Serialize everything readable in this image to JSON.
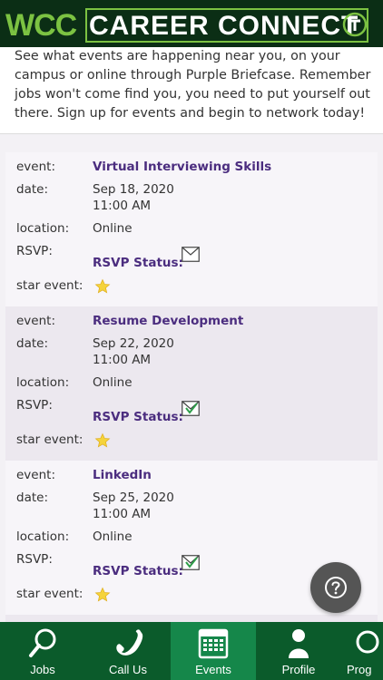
{
  "header": {
    "brand_short": "WCC",
    "brand_name": "CAREER CONNECT"
  },
  "intro": {
    "text": "See what events are happening near you, on your campus or online through Purple Briefcase. Remember jobs won't come find you, you need to put yourself out there. Sign up for events and begin to network today!"
  },
  "labels": {
    "event": "event:",
    "date": "date:",
    "location": "location:",
    "rsvp": "RSVP:",
    "rsvp_status": "RSVP Status:",
    "star_event": "star event:"
  },
  "events": [
    {
      "title": "Virtual Interviewing Skills",
      "date": "Sep 18, 2020",
      "time": "11:00 AM",
      "location": "Online",
      "rsvp_checked": false,
      "starred": true
    },
    {
      "title": "Resume Development",
      "date": "Sep 22, 2020",
      "time": "11:00 AM",
      "location": "Online",
      "rsvp_checked": true,
      "starred": true
    },
    {
      "title": "LinkedIn",
      "date": "Sep 25, 2020",
      "time": "11:00 AM",
      "location": "Online",
      "rsvp_checked": true,
      "starred": true
    }
  ],
  "tabs": [
    {
      "label": "Jobs",
      "icon": "search-icon",
      "active": false
    },
    {
      "label": "Call Us",
      "icon": "phone-icon",
      "active": false
    },
    {
      "label": "Events",
      "icon": "calendar-icon",
      "active": true
    },
    {
      "label": "Profile",
      "icon": "person-icon",
      "active": false
    },
    {
      "label": "Prog",
      "icon": "program-icon",
      "active": false
    }
  ],
  "colors": {
    "header_bg": "#0b2e15",
    "brand_green": "#7cc242",
    "tab_bg": "#0b5b2b",
    "tab_active": "#15874a",
    "link_purple": "#4b2d7f"
  }
}
